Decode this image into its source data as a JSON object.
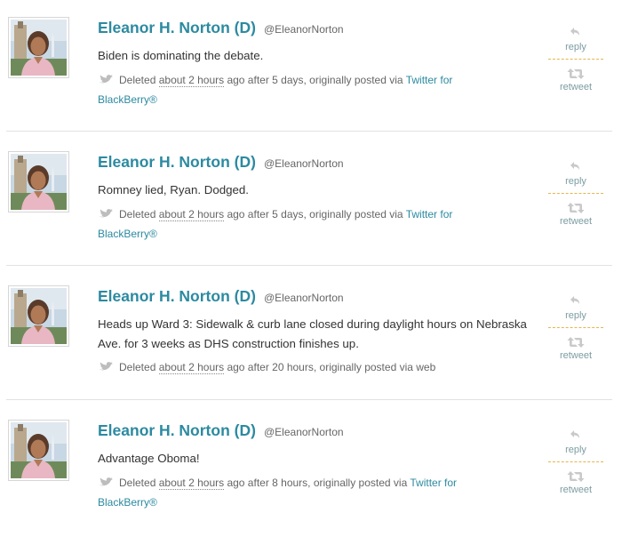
{
  "tweets": [
    {
      "author": "Eleanor H. Norton (D)",
      "handle": "@EleanorNorton",
      "text": "Biden is dominating the debate.",
      "deleted_label": "Deleted",
      "relative_time": "about 2 hours",
      "after_text": "ago after 5 days, originally posted via",
      "source": "Twitter for BlackBerry®",
      "reply_label": "reply",
      "retweet_label": "retweet"
    },
    {
      "author": "Eleanor H. Norton (D)",
      "handle": "@EleanorNorton",
      "text": "Romney lied, Ryan. Dodged.",
      "deleted_label": "Deleted",
      "relative_time": "about 2 hours",
      "after_text": "ago after 5 days, originally posted via",
      "source": "Twitter for BlackBerry®",
      "reply_label": "reply",
      "retweet_label": "retweet"
    },
    {
      "author": "Eleanor H. Norton (D)",
      "handle": "@EleanorNorton",
      "text": "Heads up Ward 3: Sidewalk & curb lane closed during daylight hours on Nebraska Ave. for 3 weeks as DHS construction finishes up.",
      "deleted_label": "Deleted",
      "relative_time": "about 2 hours",
      "after_text": "ago after 20 hours, originally posted via web",
      "source": "",
      "reply_label": "reply",
      "retweet_label": "retweet"
    },
    {
      "author": "Eleanor H. Norton (D)",
      "handle": "@EleanorNorton",
      "text": "Advantage Oboma!",
      "deleted_label": "Deleted",
      "relative_time": "about 2 hours",
      "after_text": "ago after 8 hours, originally posted via",
      "source": "Twitter for BlackBerry®",
      "reply_label": "reply",
      "retweet_label": "retweet"
    }
  ],
  "colors": {
    "name": "#2c8aa0",
    "link": "#2c8aa0",
    "meta_text": "#666666",
    "action_text": "#7c9ca3",
    "action_divider": "#e8b44c",
    "row_divider": "#e2e2e2"
  },
  "icons": {
    "avatar": "profile-photo",
    "deleted": "bird-icon",
    "reply": "reply-arrow-icon",
    "retweet": "retweet-icon"
  }
}
